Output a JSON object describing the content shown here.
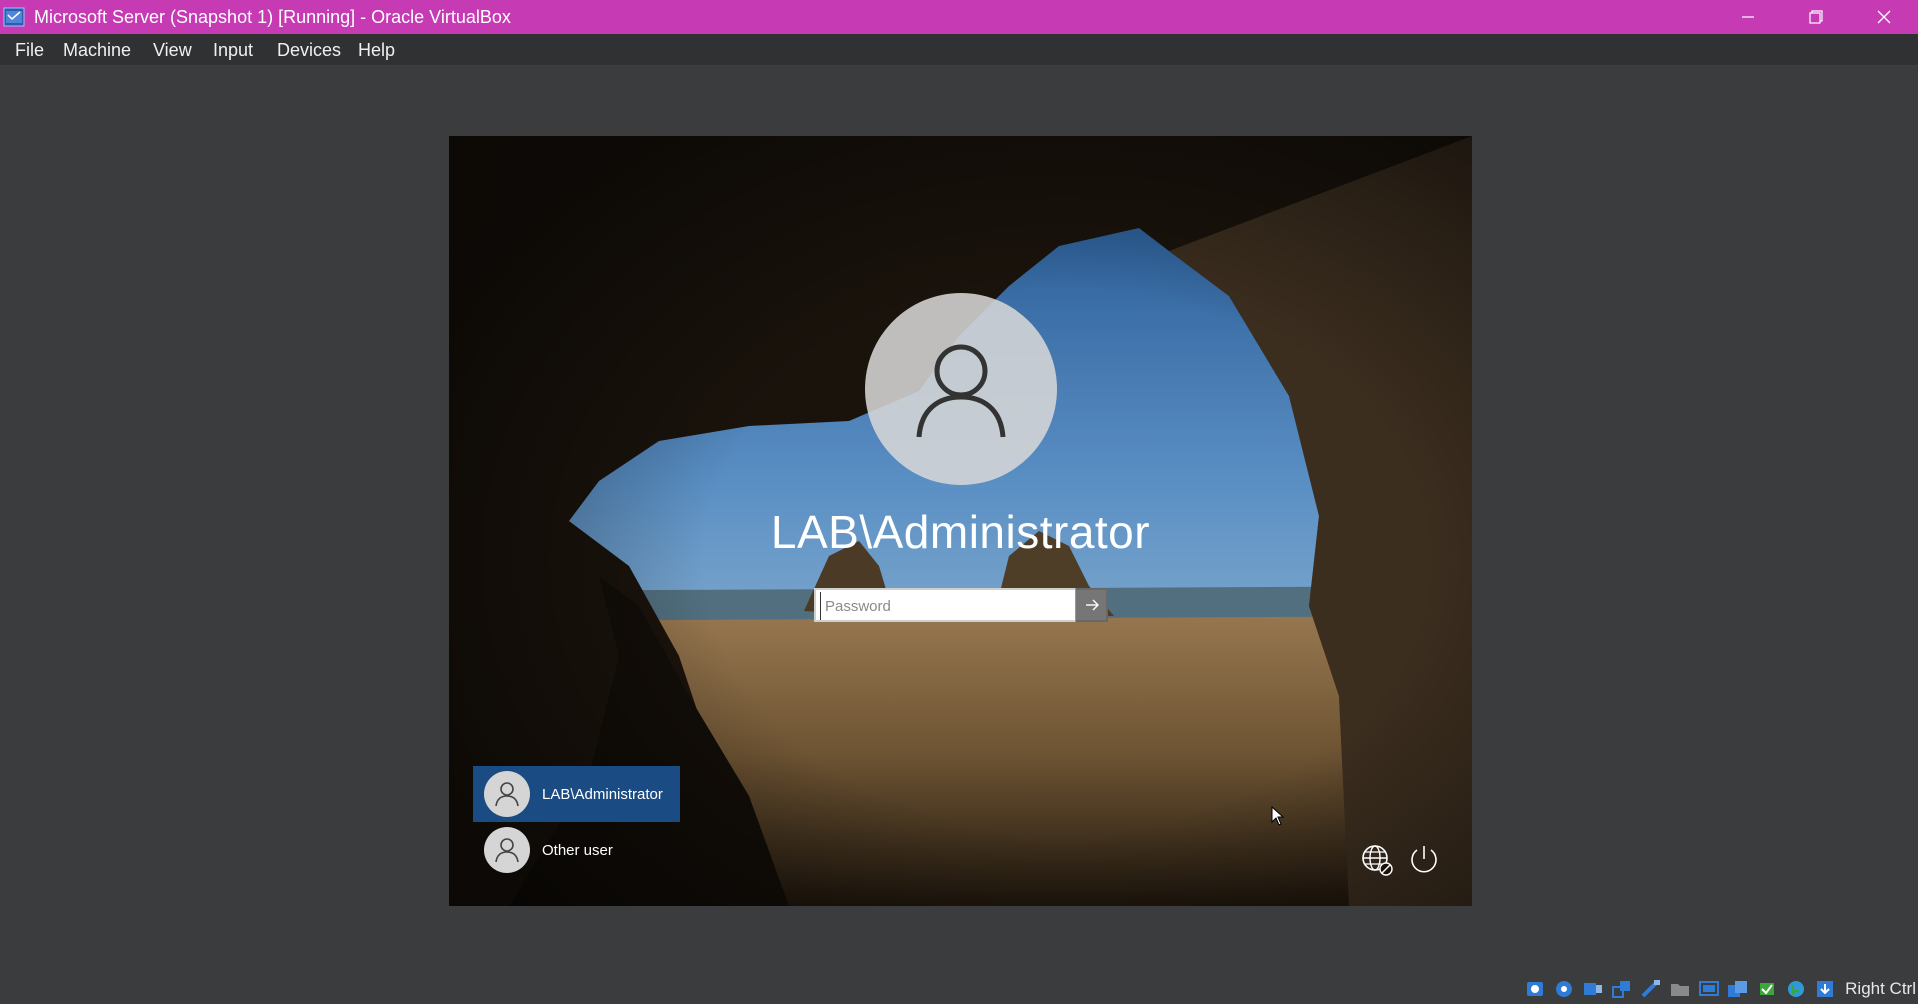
{
  "window": {
    "title": "Microsoft Server (Snapshot 1) [Running] - Oracle VirtualBox",
    "accent_color": "#c63ab4",
    "controls": [
      "minimize-icon",
      "restore-icon",
      "close-icon"
    ]
  },
  "menu": {
    "items": [
      "File",
      "Machine",
      "View",
      "Input",
      "Devices",
      "Help"
    ]
  },
  "login": {
    "account_name": "LAB\\Administrator",
    "password_placeholder": "Password",
    "password_value": "",
    "users": [
      {
        "label": "LAB\\Administrator",
        "selected": true
      },
      {
        "label": "Other user",
        "selected": false
      }
    ],
    "bottom_icons": [
      "network-icon",
      "power-icon"
    ]
  },
  "statusbar": {
    "icons": [
      "hard-disk-icon",
      "optical-drive-icon",
      "audio-icon",
      "network-adapter-icon",
      "usb-icon",
      "shared-folders-icon",
      "display-icon",
      "video-capture-icon",
      "cpu-icon",
      "mouse-integration-icon",
      "keyboard-capture-icon"
    ],
    "host_key": "Right Ctrl"
  }
}
